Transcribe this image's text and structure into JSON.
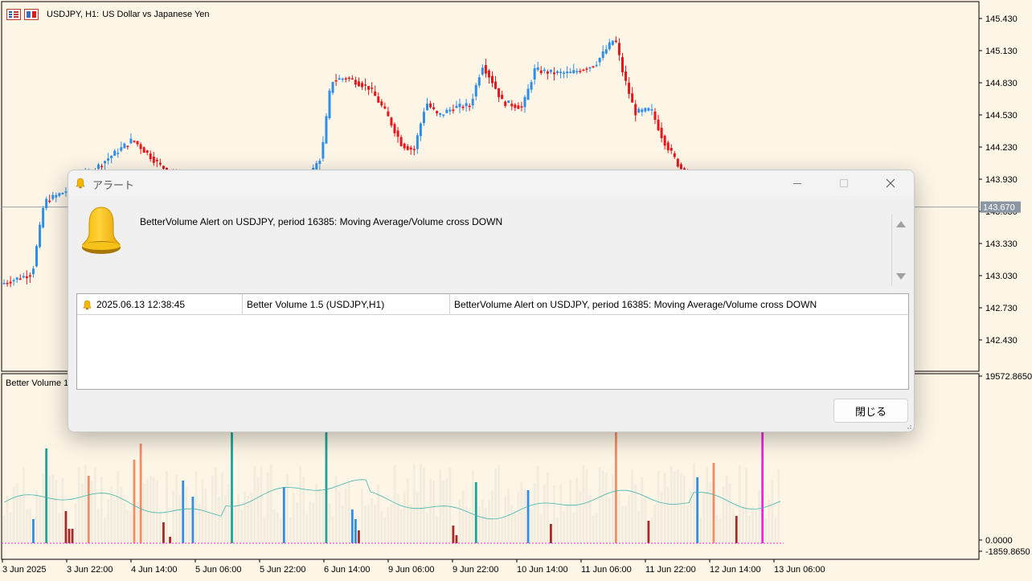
{
  "chart": {
    "symbol": "USDJPY, H1:",
    "description": "US Dollar vs Japanese Yen",
    "indicator_name": "Better Volume 1",
    "current_price": "143.670",
    "price_axis": [
      "145.430",
      "145.130",
      "144.830",
      "144.530",
      "144.230",
      "143.930",
      "143.630",
      "143.330",
      "143.030",
      "142.730",
      "142.430"
    ],
    "volume_axis": [
      "19572.8650",
      "0.0000",
      "-1859.8650"
    ],
    "time_axis": [
      "3 Jun 2025",
      "3 Jun 22:00",
      "4 Jun 14:00",
      "5 Jun 06:00",
      "5 Jun 22:00",
      "6 Jun 14:00",
      "9 Jun 06:00",
      "9 Jun 22:00",
      "10 Jun 14:00",
      "11 Jun 06:00",
      "11 Jun 22:00",
      "12 Jun 14:00",
      "13 Jun 06:00"
    ],
    "colors": {
      "background": "#fdf5e6",
      "bull_candle": "#2f8fe8",
      "bear_candle": "#e5171d",
      "price_line": "#9aa3ad",
      "price_label_bg": "#8b96a3",
      "vol_light": "#f2ecdf",
      "vol_red": "#a52a2a",
      "vol_blue": "#2f8fe8",
      "vol_teal": "#1fa398",
      "vol_salmon": "#ef8f68",
      "vol_magenta": "#e52ad6",
      "vol_ma": "#3fb4ad"
    }
  },
  "dialog": {
    "title": "アラート",
    "message": "BetterVolume Alert on USDJPY, period 16385: Moving Average/Volume cross DOWN",
    "alerts": [
      {
        "time": "2025.06.13 12:38:45",
        "source": "Better Volume 1.5 (USDJPY,H1)",
        "message": "BetterVolume Alert on USDJPY, period 16385: Moving Average/Volume cross DOWN"
      }
    ],
    "close_label": "閉じる"
  }
}
